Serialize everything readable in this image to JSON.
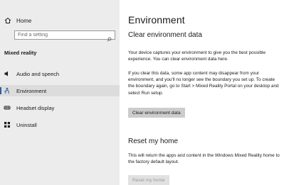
{
  "sidebar": {
    "home_label": "Home",
    "search_placeholder": "Find a setting",
    "section_label": "Mixed reality",
    "items": [
      {
        "label": "Audio and speech",
        "icon": "speaker-icon"
      },
      {
        "label": "Environment",
        "icon": "person-icon",
        "selected": true
      },
      {
        "label": "Headset display",
        "icon": "headset-icon"
      },
      {
        "label": "Uninstall",
        "icon": "apps-icon"
      }
    ]
  },
  "main": {
    "title": "Environment",
    "clear_section": {
      "heading": "Clear environment data",
      "para1": "Your device captures your environment to give you the best possible experience. You can clear environment data here.",
      "para2": "If you clear this data, some app content may disappear from your environment, and you'll no longer see the boundary you set up. To create the boundary again, go to Start > Mixed Reality Portal on your desktop and select Run setup.",
      "button": "Clear environment data"
    },
    "reset_section": {
      "heading": "Reset my home",
      "para": "This will return the apps and content in the Windows Mixed Reality home to the factory default layout.",
      "button": "Reset my home"
    }
  },
  "colors": {
    "sidebar_bg": "#ececec",
    "accent": "#2d5f9e",
    "button_bg": "#cccccc",
    "button_disabled_bg": "#e1e1e1"
  }
}
